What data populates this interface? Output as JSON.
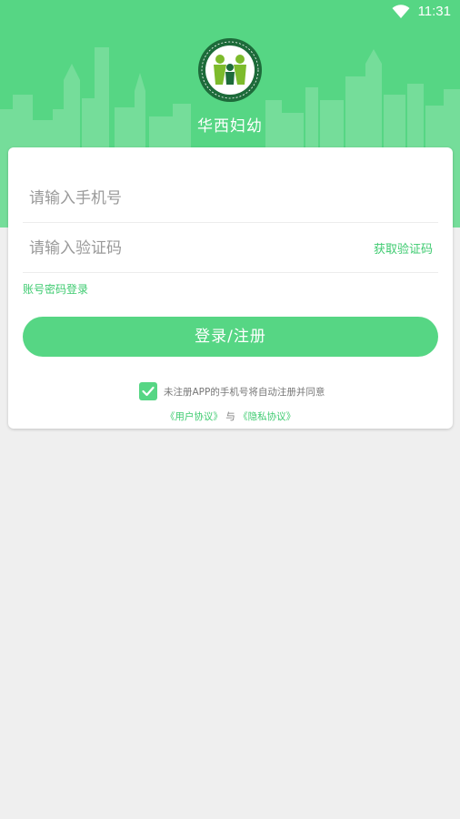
{
  "status_bar": {
    "time": "11:31",
    "wifi_icon": "wifi-icon"
  },
  "header": {
    "app_name": "华西妇幼",
    "logo_icon": "hospital-logo-icon"
  },
  "form": {
    "phone_placeholder": "请输入手机号",
    "code_placeholder": "请输入验证码",
    "get_code_label": "获取验证码",
    "password_login_label": "账号密码登录",
    "submit_label": "登录/注册",
    "agree_checked": true,
    "agree_text": "未注册APP的手机号将自动注册并同意",
    "user_agreement": "《用户协议》",
    "and_text": "与",
    "privacy_policy": "《隐私协议》"
  },
  "colors": {
    "brand_green": "#56d684",
    "link_green": "#3ecb70",
    "background": "#efefef"
  }
}
